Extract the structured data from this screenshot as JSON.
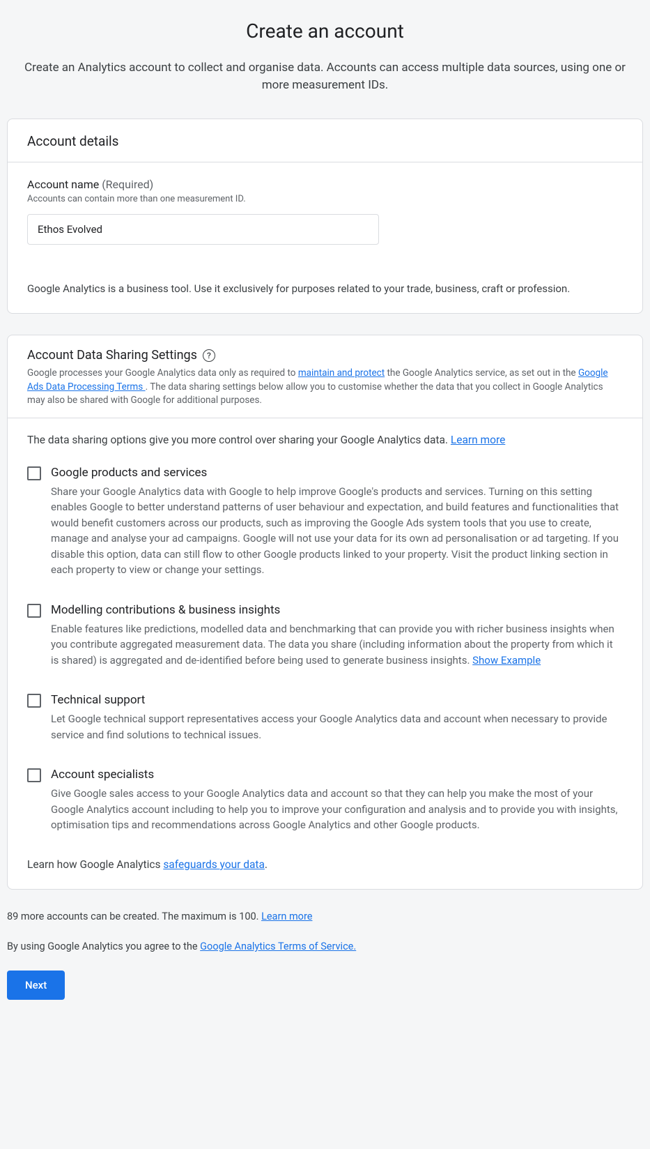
{
  "page": {
    "title": "Create an account",
    "subtitle": "Create an Analytics account to collect and organise data. Accounts can access multiple data sources, using one or more measurement IDs."
  },
  "account_details": {
    "card_title": "Account details",
    "name_label": "Account name",
    "required_text": "(Required)",
    "name_helper": "Accounts can contain more than one measurement ID.",
    "name_value": "Ethos Evolved",
    "business_note": "Google Analytics is a business tool. Use it exclusively for purposes related to your trade, business, craft or profession."
  },
  "sharing": {
    "title": "Account Data Sharing Settings",
    "desc_1": "Google processes your Google Analytics data only as required to ",
    "link_maintain": "maintain and protect",
    "desc_2": " the Google Analytics service, as set out in the ",
    "link_terms": "Google Ads Data Processing Terms ",
    "desc_3": ". The data sharing settings below allow you to customise whether the data that you collect in Google Analytics may also be shared with Google for additional purposes.",
    "intro": "The data sharing options give you more control over sharing your Google Analytics data. ",
    "learn_more": "Learn more",
    "items": [
      {
        "title": "Google products and services",
        "desc": "Share your Google Analytics data with Google to help improve Google's products and services. Turning on this setting enables Google to better understand patterns of user behaviour and expectation, and build features and functionalities that would benefit customers across our products, such as improving the Google Ads system tools that you use to create, manage and analyse your ad campaigns. Google will not use your data for its own ad personalisation or ad targeting. If you disable this option, data can still flow to other Google products linked to your property. Visit the product linking section in each property to view or change your settings."
      },
      {
        "title": "Modelling contributions & business insights",
        "desc": "Enable features like predictions, modelled data and benchmarking that can provide you with richer business insights when you contribute aggregated measurement data. The data you share (including information about the property from which it is shared) is aggregated and de-identified before being used to generate business insights. ",
        "link": "Show Example"
      },
      {
        "title": "Technical support",
        "desc": "Let Google technical support representatives access your Google Analytics data and account when necessary to provide service and find solutions to technical issues."
      },
      {
        "title": "Account specialists",
        "desc": "Give Google sales access to your Google Analytics data and account so that they can help you make the most of your Google Analytics account including to help you to improve your configuration and analysis and to provide you with insights, optimisation tips and recommendations across Google Analytics and other Google products."
      }
    ],
    "safeguard_prefix": "Learn how Google Analytics ",
    "safeguard_link": "safeguards your data",
    "safeguard_suffix": "."
  },
  "footer": {
    "accounts_remaining": "89 more accounts can be created. The maximum is 100. ",
    "accounts_learn_more": "Learn more",
    "tos_prefix": "By using Google Analytics you agree to the ",
    "tos_link": "Google Analytics Terms of Service.",
    "next_button": "Next"
  }
}
